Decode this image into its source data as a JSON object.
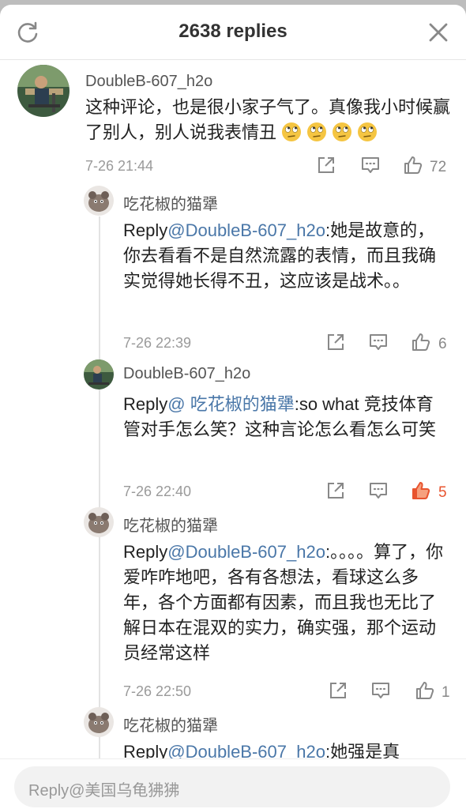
{
  "header": {
    "title": "2638 replies"
  },
  "comments": [
    {
      "username": "DoubleB-607_h2o",
      "text": "这种评论，也是很小家子气了。真像我小时候赢了别人，别人说我表情丑",
      "time": "7-26 21:44",
      "likes": "72",
      "emoji": "rolling-eyes",
      "emoji_count": 4
    },
    {
      "username": "吃花椒的猫犟",
      "reply_prefix": "Reply",
      "mention": "@DoubleB-607_h2o",
      "text": ":她是故意的，你去看看不是自然流露的表情，而且我确实觉得她长得不丑，这应该是战术。。",
      "time": "7-26 22:39",
      "likes": "6"
    },
    {
      "username": "DoubleB-607_h2o",
      "reply_prefix": "Reply",
      "mention": "@ 吃花椒的猫犟",
      "text": ":so what 竞技体育管对手怎么笑？这种言论怎么看怎么可笑",
      "time": "7-26 22:40",
      "likes": "5",
      "liked": true
    },
    {
      "username": "吃花椒的猫犟",
      "reply_prefix": "Reply",
      "mention": "@DoubleB-607_h2o",
      "text": ":。。。。算了，你爱咋咋地吧，各有各想法，看球这么多年，各个方面都有因素，而且我也无比了解日本在混双的实力，确实强，那个运动员经常这样",
      "time": "7-26 22:50",
      "likes": "1"
    },
    {
      "username": "吃花椒的猫犟",
      "reply_prefix": "Reply",
      "mention": "@DoubleB-607_h2o",
      "text": ":她强是真"
    }
  ],
  "input": {
    "placeholder": "Reply@美国乌龟狒狒"
  },
  "colors": {
    "mention": "#4a77a8",
    "liked": "#e8542f",
    "muted": "#9a9a9a"
  }
}
